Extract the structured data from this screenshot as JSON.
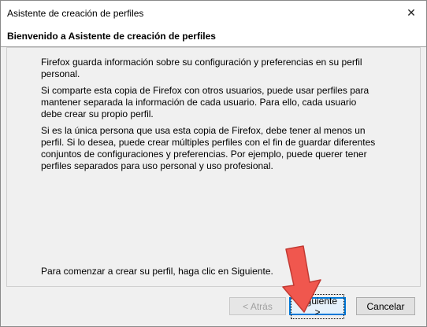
{
  "window": {
    "title": "Asistente de creación de perfiles",
    "close_glyph": "✕"
  },
  "header": {
    "title": "Bienvenido a Asistente de creación de perfiles"
  },
  "content": {
    "paragraph_1": "Firefox guarda información sobre su configuración y preferencias en su perfil personal.",
    "paragraph_2": "Si comparte esta copia de Firefox con otros usuarios, puede usar perfiles para mantener separada la información de cada usuario. Para ello, cada usuario debe crear su propio perfil.",
    "paragraph_3": "Si es la única persona que usa esta copia de Firefox, debe tener al menos un perfil. Si lo desea, puede crear múltiples perfiles con el fin de guardar diferentes conjuntos de configuraciones y preferencias. Por ejemplo, puede querer tener perfiles separados para uso personal y uso profesional.",
    "paragraph_4": "Para comenzar a crear su perfil, haga clic en Siguiente."
  },
  "buttons": {
    "back_label": "< Atrás",
    "next_label": "Siguiente >",
    "cancel_label": "Cancelar"
  },
  "colors": {
    "accent": "#0078d7",
    "annotation_arrow": "#f0574e"
  },
  "icons": {
    "close": "close-icon",
    "annotation": "down-arrow-annotation-icon"
  }
}
